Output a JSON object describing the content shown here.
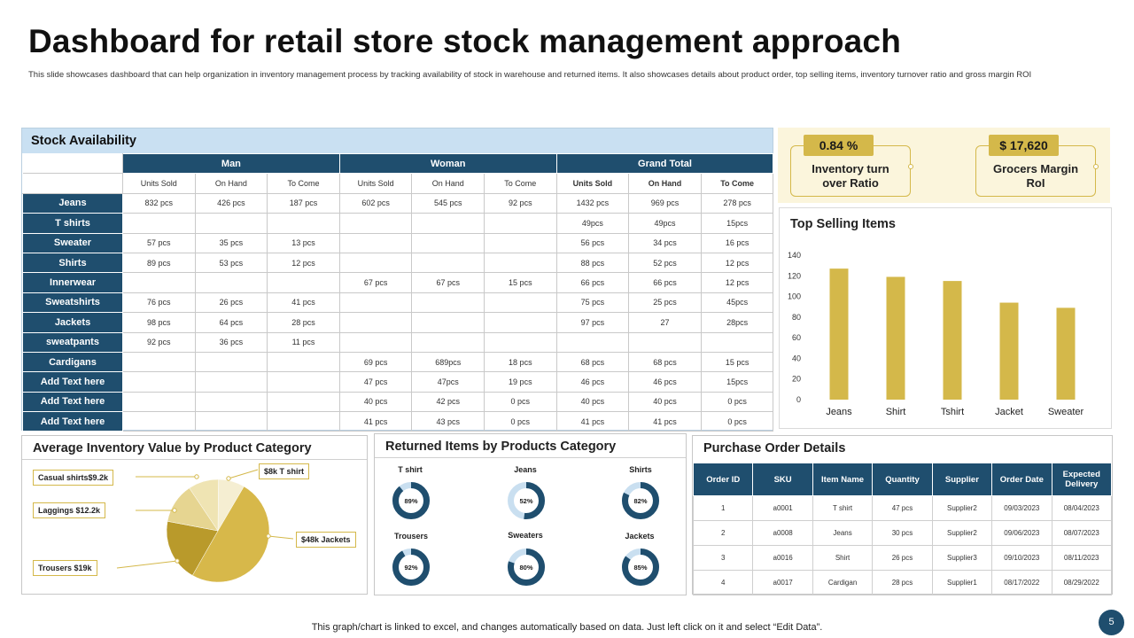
{
  "title": "Dashboard for retail store stock management approach",
  "subtitle": "This slide showcases dashboard that can help organization in inventory management  process by tracking availability of stock in  warehouse and returned items. It also showcases details about product order, top selling  items, inventory turnover ratio and gross margin ROI",
  "stock": {
    "title": "Stock Availability",
    "groups": [
      "Man",
      "Woman",
      "Grand Total"
    ],
    "subheaders": [
      "Units Sold",
      "On Hand",
      "To Come",
      "Units Sold",
      "On Hand",
      "To Come",
      "Units Sold",
      "On Hand",
      "To Come"
    ],
    "rows": [
      {
        "label": "Jeans",
        "cells": [
          "832 pcs",
          "426 pcs",
          "187 pcs",
          "602 pcs",
          "545 pcs",
          "92 pcs",
          "1432 pcs",
          "969 pcs",
          "278 pcs"
        ]
      },
      {
        "label": "T shirts",
        "cells": [
          "",
          "",
          "",
          "",
          "",
          "",
          "49pcs",
          "49pcs",
          "15pcs"
        ]
      },
      {
        "label": "Sweater",
        "cells": [
          "57 pcs",
          "35 pcs",
          "13 pcs",
          "",
          "",
          "",
          "56 pcs",
          "34 pcs",
          "16 pcs"
        ]
      },
      {
        "label": "Shirts",
        "cells": [
          "89 pcs",
          "53 pcs",
          "12 pcs",
          "",
          "",
          "",
          "88 pcs",
          "52 pcs",
          "12 pcs"
        ]
      },
      {
        "label": "Innerwear",
        "cells": [
          "",
          "",
          "",
          "67 pcs",
          "67 pcs",
          "15 pcs",
          "66 pcs",
          "66 pcs",
          "12 pcs"
        ]
      },
      {
        "label": "Sweatshirts",
        "cells": [
          "76 pcs",
          "26 pcs",
          "41 pcs",
          "",
          "",
          "",
          "75 pcs",
          "25 pcs",
          "45pcs"
        ]
      },
      {
        "label": "Jackets",
        "cells": [
          "98 pcs",
          "64 pcs",
          "28 pcs",
          "",
          "",
          "",
          "97 pcs",
          "27",
          "28pcs"
        ]
      },
      {
        "label": "sweatpants",
        "cells": [
          "92 pcs",
          "36 pcs",
          "11 pcs",
          "",
          "",
          "",
          "",
          "",
          ""
        ]
      },
      {
        "label": "Cardigans",
        "cells": [
          "",
          "",
          "",
          "69 pcs",
          "689pcs",
          "18 pcs",
          "68 pcs",
          "68 pcs",
          "15 pcs"
        ]
      },
      {
        "label": "Add Text here",
        "cells": [
          "",
          "",
          "",
          "47 pcs",
          "47pcs",
          "19 pcs",
          "46 pcs",
          "46 pcs",
          "15pcs"
        ]
      },
      {
        "label": "Add Text here",
        "cells": [
          "",
          "",
          "",
          "40 pcs",
          "42 pcs",
          "0 pcs",
          "40 pcs",
          "40 pcs",
          "0 pcs"
        ]
      },
      {
        "label": "Add Text here",
        "cells": [
          "",
          "",
          "",
          "41 pcs",
          "43 pcs",
          "0 pcs",
          "41 pcs",
          "41 pcs",
          "0 pcs"
        ]
      }
    ]
  },
  "kpis": [
    {
      "value": "0.84 %",
      "label_line1": "Inventory turn",
      "label_line2": "over Ratio"
    },
    {
      "value": "$ 17,620",
      "label_line1": "Grocers Margin",
      "label_line2": "RoI"
    }
  ],
  "top_selling": {
    "title": "Top Selling Items"
  },
  "avg_inventory": {
    "title": "Average Inventory Value by Product Category",
    "callouts": [
      "Casual shirts$9.2k",
      "Laggings $12.2k",
      "Trousers $19k",
      "$8k T shirt",
      "$48k Jackets"
    ]
  },
  "returned": {
    "title": "Returned Items by Products Category",
    "items": [
      {
        "label": "T shirt",
        "percent": 89,
        "text": "89%"
      },
      {
        "label": "Jeans",
        "percent": 52,
        "text": "52%"
      },
      {
        "label": "Shirts",
        "percent": 82,
        "text": "82%"
      },
      {
        "label": "Trousers",
        "percent": 92,
        "text": "92%"
      },
      {
        "label": "Sweaters",
        "percent": 80,
        "text": "80%"
      },
      {
        "label": "Jackets",
        "percent": 85,
        "text": "85%"
      }
    ]
  },
  "purchase_orders": {
    "title": "Purchase Order Details",
    "columns": [
      "Order ID",
      "SKU",
      "Item Name",
      "Quantity",
      "Supplier",
      "Order Date",
      "Expected Delivery"
    ],
    "rows": [
      [
        "1",
        "a0001",
        "T shirt",
        "47 pcs",
        "Supplier2",
        "09/03/2023",
        "08/04/2023"
      ],
      [
        "2",
        "a0008",
        "Jeans",
        "30 pcs",
        "Supplier2",
        "09/06/2023",
        "08/07/2023"
      ],
      [
        "3",
        "a0016",
        "Shirt",
        "26 pcs",
        "Supplier3",
        "09/10/2023",
        "08/11/2023"
      ],
      [
        "4",
        "a0017",
        "Cardigan",
        "28 pcs",
        "Supplier1",
        "08/17/2022",
        "08/29/2022"
      ]
    ]
  },
  "footer": "This graph/chart is linked to excel,  and changes automatically based on data. Just left click on it and select “Edit Data”.",
  "page_number": "5",
  "colors": {
    "navy": "#1f4e6e",
    "gold": "#d4b84a",
    "light_blue": "#c9e0f2",
    "cream": "#fbf5dc",
    "donut_track": "#c9dff0"
  },
  "chart_data": [
    {
      "type": "bar",
      "title": "Top Selling Items",
      "categories": [
        "Jeans",
        "Shirt",
        "Tshirt",
        "Jacket",
        "Sweater"
      ],
      "values": [
        127,
        119,
        115,
        94,
        89
      ],
      "ylim": [
        0,
        140
      ],
      "yticks": [
        0,
        20,
        40,
        60,
        80,
        100,
        120,
        140
      ],
      "grid": false,
      "color": "#d4b84a"
    },
    {
      "type": "pie",
      "title": "Average Inventory Value by Product Category",
      "labels": [
        "Jackets",
        "Trousers",
        "Laggings",
        "Casual shirts",
        "T shirt"
      ],
      "values": [
        48,
        19,
        12.2,
        9.2,
        8
      ],
      "colors": [
        "#d7b84a",
        "#b99a2b",
        "#e6d591",
        "#efe4b3",
        "#f5eed2"
      ]
    }
  ]
}
